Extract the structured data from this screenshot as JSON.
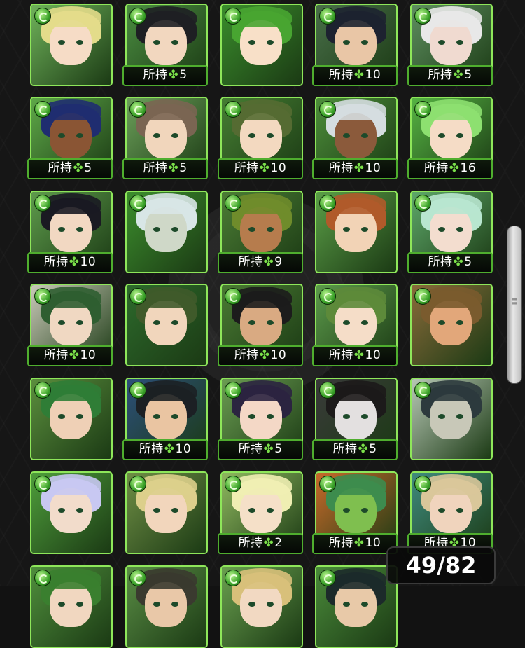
{
  "owned_prefix": "所持",
  "clover": "✤",
  "counter": "49/82",
  "colors": {
    "border": "#8ee65a",
    "accent": "#7be04a"
  },
  "rows": [
    [
      {
        "hair": "#e3dc8a",
        "skin": "#f6dcc6",
        "bg": "#6fb25a",
        "owned": null
      },
      {
        "hair": "#1e1f23",
        "skin": "#f2d7bf",
        "bg": "#4b8d41",
        "owned": "5"
      },
      {
        "hair": "#48a531",
        "skin": "#f8e0c8",
        "bg": "#3a8d2c",
        "owned": null
      },
      {
        "hair": "#1d2230",
        "skin": "#e9c6a6",
        "bg": "#496f49",
        "owned": "10"
      },
      {
        "hair": "#e8e8e8",
        "skin": "#f0dad0",
        "bg": "#5e8f60",
        "owned": "5"
      }
    ],
    [
      {
        "hair": "#1f2d70",
        "skin": "#8a5534",
        "bg": "#5ea848",
        "owned": "5"
      },
      {
        "hair": "#7a6552",
        "skin": "#f1d6bc",
        "bg": "#6ca05a",
        "owned": "5"
      },
      {
        "hair": "#556b32",
        "skin": "#f3d9c0",
        "bg": "#467e33",
        "owned": "10"
      },
      {
        "hair": "#d5dde0",
        "skin": "#8b5a3b",
        "bg": "#4d8e3a",
        "owned": "10"
      },
      {
        "hair": "#8de070",
        "skin": "#f5dcc6",
        "bg": "#56b443",
        "owned": "16"
      }
    ],
    [
      {
        "hair": "#1a1a22",
        "skin": "#f2d8c2",
        "bg": "#5e9b4c",
        "owned": "10"
      },
      {
        "hair": "#d8e6e6",
        "skin": "#cfd8c8",
        "bg": "#3c8e2d",
        "owned": null
      },
      {
        "hair": "#6f8c2b",
        "skin": "#b67c4d",
        "bg": "#4c7d35",
        "owned": "9"
      },
      {
        "hair": "#b05a2a",
        "skin": "#f2d3b6",
        "bg": "#5b9e47",
        "owned": null
      },
      {
        "hair": "#b8e6cf",
        "skin": "#f3ddcf",
        "bg": "#5ea86a",
        "owned": "5"
      }
    ],
    [
      {
        "hair": "#2f5e31",
        "skin": "#f0d8c2",
        "bg": "#c9c9b8",
        "owned": "10"
      },
      {
        "hair": "#3f5a2a",
        "skin": "#f1d6bc",
        "bg": "#2d6a2c",
        "owned": null
      },
      {
        "hair": "#1c1c1c",
        "skin": "#d9aa82",
        "bg": "#4a7a33",
        "owned": "10"
      },
      {
        "hair": "#5d8a3a",
        "skin": "#f5ddc8",
        "bg": "#5c9a4b",
        "owned": "10"
      },
      {
        "hair": "#7a5b2e",
        "skin": "#e2a77a",
        "bg": "#8a6b3a",
        "owned": null
      }
    ],
    [
      {
        "hair": "#2f7d36",
        "skin": "#efd0b6",
        "bg": "#5b8e3d",
        "owned": null
      },
      {
        "hair": "#1c2024",
        "skin": "#eac5a2",
        "bg": "#2c4f7a",
        "owned": "10"
      },
      {
        "hair": "#2b2440",
        "skin": "#f4d8c6",
        "bg": "#6b9d52",
        "owned": "5"
      },
      {
        "hair": "#1c1a1a",
        "skin": "#e3e0e0",
        "bg": "#3a3a3a",
        "owned": "5"
      },
      {
        "hair": "#2c3a3d",
        "skin": "#c8c8b8",
        "bg": "#b8c8b6",
        "owned": null
      }
    ],
    [
      {
        "hair": "#c8c8f2",
        "skin": "#f2dccb",
        "bg": "#4e9d3b",
        "owned": null
      },
      {
        "hair": "#dccf8b",
        "skin": "#f2d6bc",
        "bg": "#6f8e45",
        "owned": null
      },
      {
        "hair": "#efeeb2",
        "skin": "#f5e0c8",
        "bg": "#8fb85f",
        "owned": "2"
      },
      {
        "hair": "#3d8c4e",
        "skin": "#7fbf4f",
        "bg": "#c86a2a",
        "owned": "10"
      },
      {
        "hair": "#d9c79a",
        "skin": "#f0d4bd",
        "bg": "#3f8b7e",
        "owned": "10"
      }
    ],
    [
      {
        "hair": "#3a7f2f",
        "skin": "#f1d7c0",
        "bg": "#4f8e3c",
        "owned": null
      },
      {
        "hair": "#3a3a2f",
        "skin": "#e9c8a8",
        "bg": "#5a8d45",
        "owned": null
      },
      {
        "hair": "#d8c07a",
        "skin": "#f2d9c2",
        "bg": "#6aa04f",
        "owned": null
      },
      {
        "hair": "#1c2a2a",
        "skin": "#e8c9a8",
        "bg": "#4a8a3a",
        "owned": null
      },
      null
    ]
  ]
}
